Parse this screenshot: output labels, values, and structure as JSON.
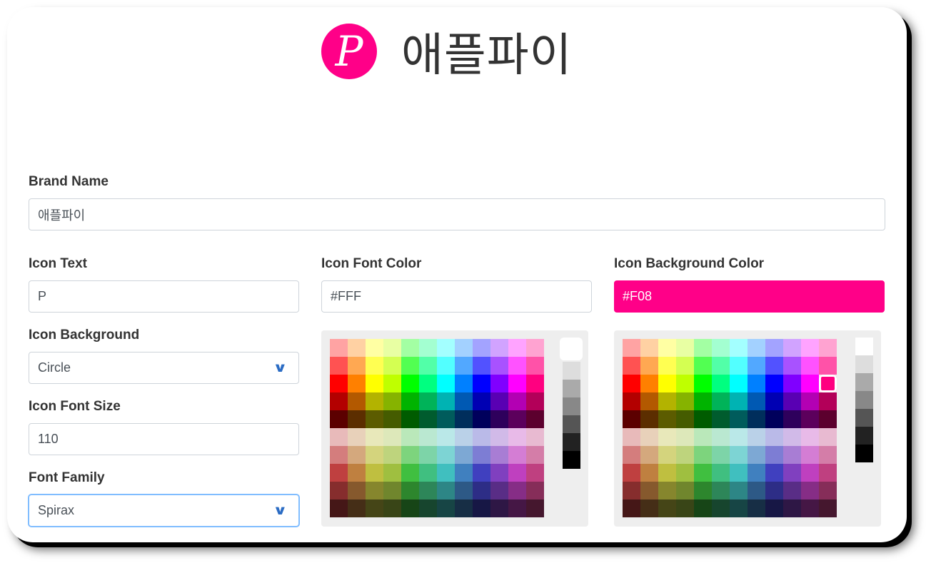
{
  "brand": {
    "name": "애플파이",
    "icon_text": "P"
  },
  "colors": {
    "icon_font": "#FFF",
    "icon_background": "#F08",
    "accent": "#2b6cc4"
  },
  "form": {
    "brand_name": {
      "label": "Brand Name",
      "value": "애플파이"
    },
    "icon_text": {
      "label": "Icon Text",
      "value": "P"
    },
    "icon_font_color": {
      "label": "Icon Font Color",
      "value": "#FFF"
    },
    "icon_background_color": {
      "label": "Icon Background Color",
      "value": "#F08"
    },
    "icon_background": {
      "label": "Icon Background",
      "value": "Circle"
    },
    "icon_font_size": {
      "label": "Icon Font Size",
      "value": "110"
    },
    "font_family": {
      "label": "Font Family",
      "value": "Spirax"
    }
  },
  "palette": {
    "hues": [
      0,
      30,
      60,
      75,
      120,
      150,
      180,
      210,
      240,
      270,
      300,
      330
    ],
    "grays": [
      "#FFFFFF",
      "#DDDDDD",
      "#AAAAAA",
      "#888888",
      "#555555",
      "#222222",
      "#000000"
    ],
    "font_picker_selected_gray": 0,
    "bg_picker_selected": {
      "row": 2,
      "col": 11
    }
  }
}
